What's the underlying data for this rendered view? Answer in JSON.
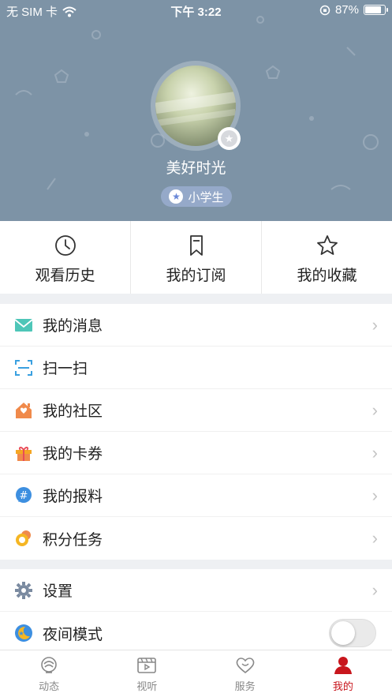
{
  "status_bar": {
    "carrier": "无 SIM 卡",
    "time": "下午 3:22",
    "battery": "87%",
    "battery_level": 0.87
  },
  "profile": {
    "nickname": "美好时光",
    "rank": "小学生"
  },
  "shortcuts": [
    {
      "label": "观看历史",
      "icon": "clock-icon"
    },
    {
      "label": "我的订阅",
      "icon": "bookmark-icon"
    },
    {
      "label": "我的收藏",
      "icon": "star-icon"
    }
  ],
  "menu_group_1": [
    {
      "label": "我的消息",
      "icon": "mail-icon",
      "color": "#4ec6b8"
    },
    {
      "label": "扫一扫",
      "icon": "scan-icon",
      "color": "#3aa0e0"
    },
    {
      "label": "我的社区",
      "icon": "house-icon",
      "color": "#f08a4b"
    },
    {
      "label": "我的卡券",
      "icon": "gift-icon",
      "color": "#f5a623"
    },
    {
      "label": "我的报料",
      "icon": "hashtag-icon",
      "color": "#3d8fe0"
    },
    {
      "label": "积分任务",
      "icon": "coin-icon",
      "color": "#f5b623"
    }
  ],
  "menu_group_2": [
    {
      "label": "设置",
      "icon": "gear-icon",
      "color": "#7a8aa0"
    },
    {
      "label": "夜间模式",
      "icon": "moon-icon",
      "color": "#3d8fe0",
      "toggle_on": false
    }
  ],
  "tabbar": [
    {
      "label": "动态",
      "icon": "peony-icon",
      "active": false
    },
    {
      "label": "视听",
      "icon": "video-icon",
      "active": false
    },
    {
      "label": "服务",
      "icon": "heart-icon",
      "active": false
    },
    {
      "label": "我的",
      "icon": "person-icon",
      "active": true
    }
  ],
  "colors": {
    "header_bg": "#7d93a6",
    "accent_red": "#c8161d",
    "rank_bg": "#95a9c9"
  }
}
